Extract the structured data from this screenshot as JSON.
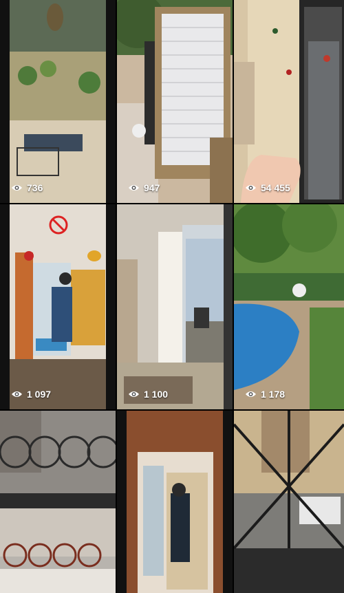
{
  "grid": {
    "items": [
      {
        "views": "736"
      },
      {
        "views": "947"
      },
      {
        "views": "54 455"
      },
      {
        "views": "1 097"
      },
      {
        "views": "1 100"
      },
      {
        "views": "1 178"
      },
      {
        "views": ""
      },
      {
        "views": ""
      },
      {
        "views": ""
      }
    ]
  },
  "icons": {
    "view_count": "eye-icon"
  }
}
